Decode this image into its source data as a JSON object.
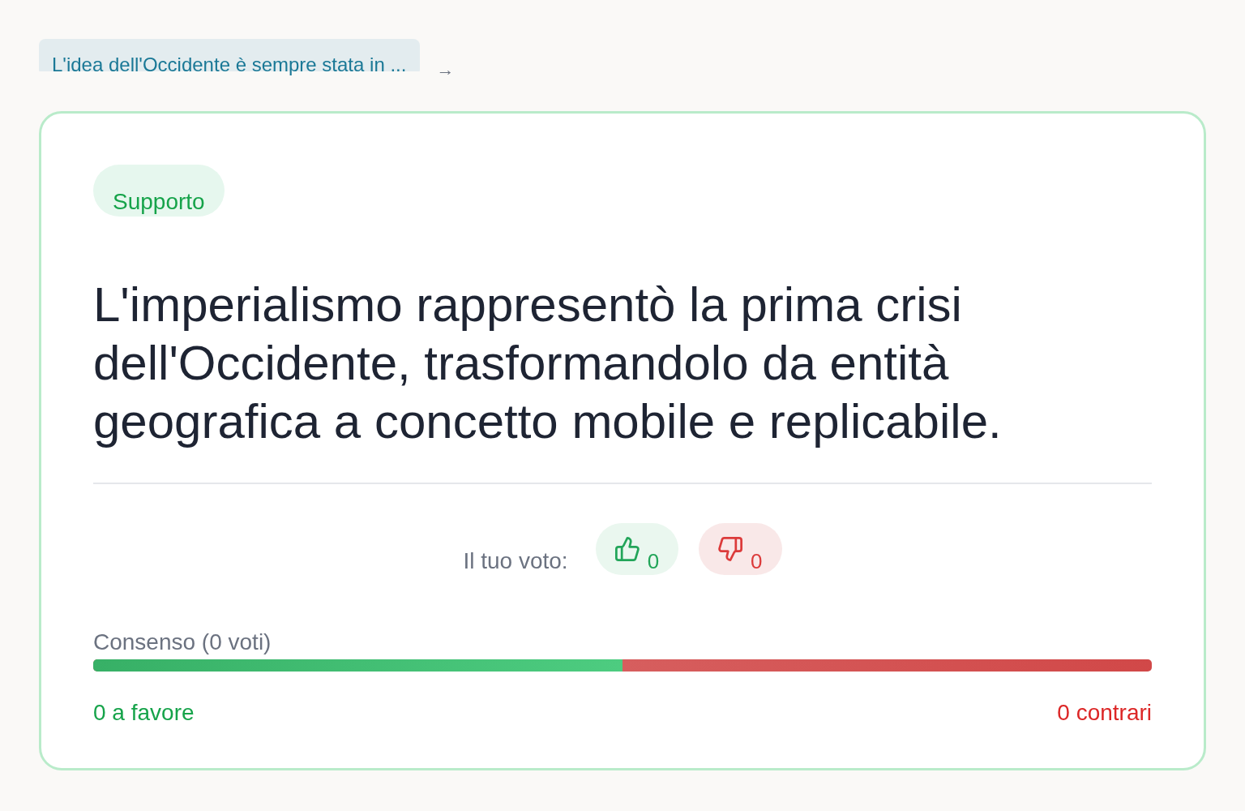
{
  "breadcrumb": {
    "link": "L'idea dell'Occidente è sempre stata in ...",
    "arrow": "→"
  },
  "card": {
    "tag": {
      "label": "Supporto",
      "kind": "support"
    },
    "statement": "L'imperialismo rappresentò la prima crisi dell'Occidente, trasformandolo da entità geografica a concetto mobile e replicabile.",
    "vote": {
      "label": "Il tuo voto:",
      "buttons": [
        {
          "kind": "up",
          "count": "0"
        },
        {
          "kind": "down",
          "count": "0"
        }
      ]
    },
    "consensus": {
      "label": "Consenso (0 voti)",
      "level": 0.5,
      "in_favor": "0 a favore",
      "against": "0 contrari"
    }
  }
}
